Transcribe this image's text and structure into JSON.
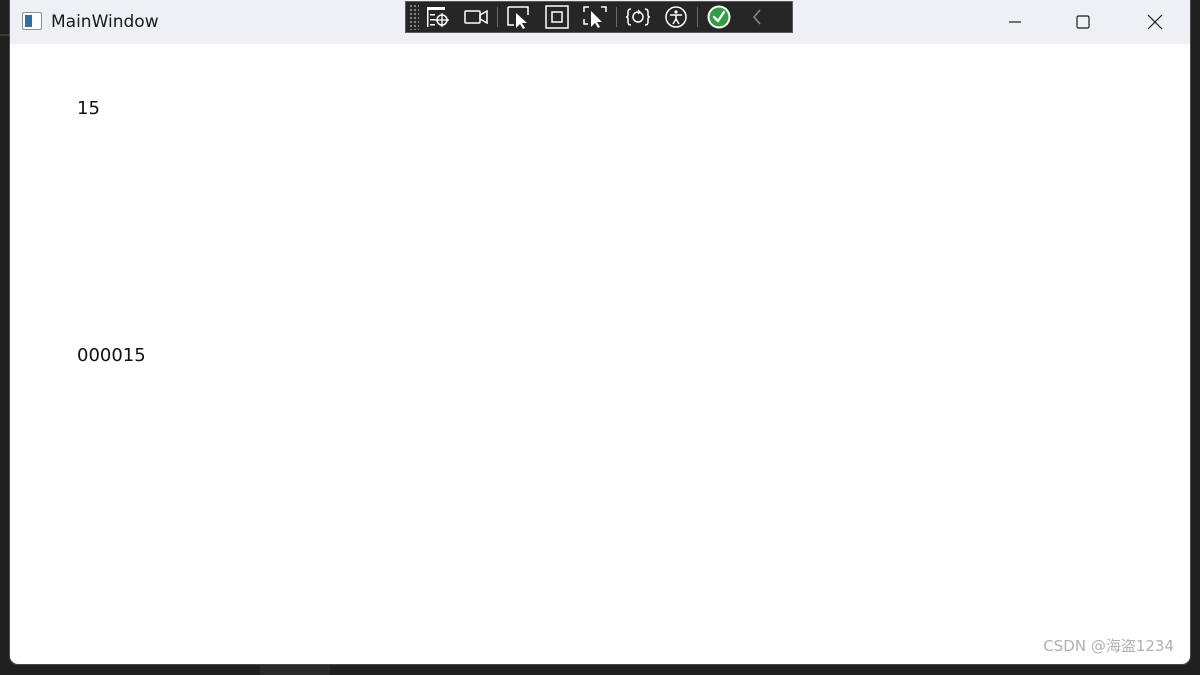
{
  "window": {
    "title": "MainWindow"
  },
  "debug_toolbar": {
    "buttons": [
      {
        "icon": "live-visual-tree-icon"
      },
      {
        "icon": "record-video-icon"
      },
      {
        "icon": "select-element-icon"
      },
      {
        "icon": "display-layout-adorners-icon"
      },
      {
        "icon": "track-focused-element-icon"
      },
      {
        "icon": "hot-reload-icon"
      },
      {
        "icon": "accessibility-icon"
      },
      {
        "icon": "binding-failures-check-icon"
      },
      {
        "icon": "collapse-chevron-left-icon"
      }
    ],
    "check_color": "#2ea043"
  },
  "content": {
    "text1": "15",
    "text2": "000015"
  },
  "watermark": "CSDN @海盗1234"
}
